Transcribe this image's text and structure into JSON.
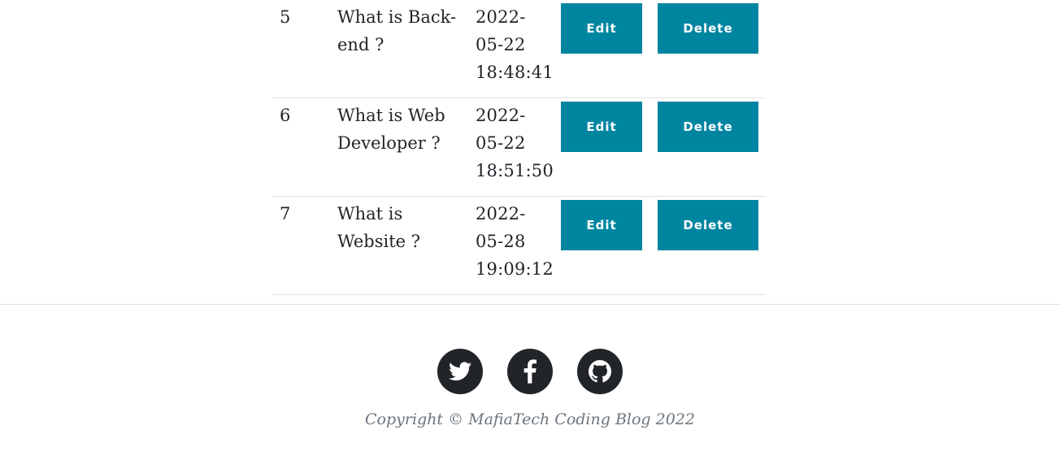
{
  "table": {
    "rows": [
      {
        "id": "5",
        "title_lines": [
          "What is Back-",
          "end ?"
        ],
        "date_lines": [
          "2022-",
          "05-22",
          "18:48:41"
        ],
        "edit_label": "Edit",
        "delete_label": "Delete"
      },
      {
        "id": "6",
        "title_lines": [
          "What is Web",
          "Developer ?"
        ],
        "date_lines": [
          "2022-",
          "05-22",
          "18:51:50"
        ],
        "edit_label": "Edit",
        "delete_label": "Delete"
      },
      {
        "id": "7",
        "title_lines": [
          "What is",
          "Website ?"
        ],
        "date_lines": [
          "2022-",
          "05-28",
          "19:09:12"
        ],
        "edit_label": "Edit",
        "delete_label": "Delete"
      }
    ]
  },
  "footer": {
    "social": [
      {
        "name": "twitter-icon"
      },
      {
        "name": "facebook-icon"
      },
      {
        "name": "github-icon"
      }
    ],
    "copyright": "Copyright © MafiaTech Coding Blog 2022"
  },
  "colors": {
    "button": "#0085a1",
    "icon_bg": "#212529",
    "muted": "#6c757d",
    "rule": "#dee2e6"
  }
}
